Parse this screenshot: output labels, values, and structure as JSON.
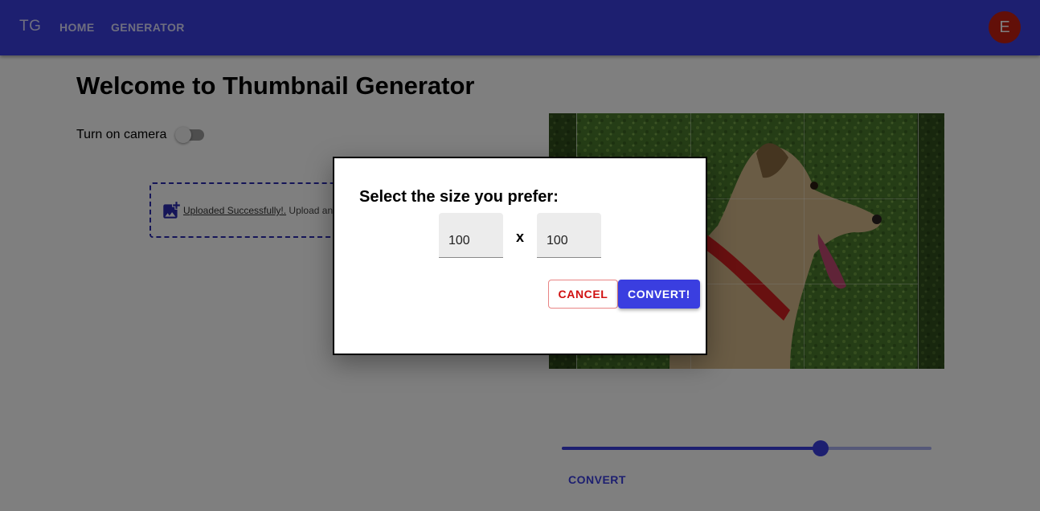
{
  "navbar": {
    "brand": "TG",
    "links": [
      "HOME",
      "GENERATOR"
    ],
    "avatar_letter": "E",
    "color": "#3a3ee0",
    "avatar_color": "#c41f10"
  },
  "main": {
    "title": "Welcome to Thumbnail Generator",
    "camera_label": "Turn on camera",
    "camera_on": false,
    "upload": {
      "icon": "add-photo-icon",
      "success_text": "Uploaded Successfully!.",
      "extra_text": " Upload another"
    },
    "slider_value": 0.7,
    "convert_label": "CONVERT"
  },
  "dialog": {
    "title": "Select the size you prefer:",
    "width_value": "100",
    "height_value": "100",
    "separator": "x",
    "cancel_label": "CANCEL",
    "convert_label": "CONVERT!"
  }
}
